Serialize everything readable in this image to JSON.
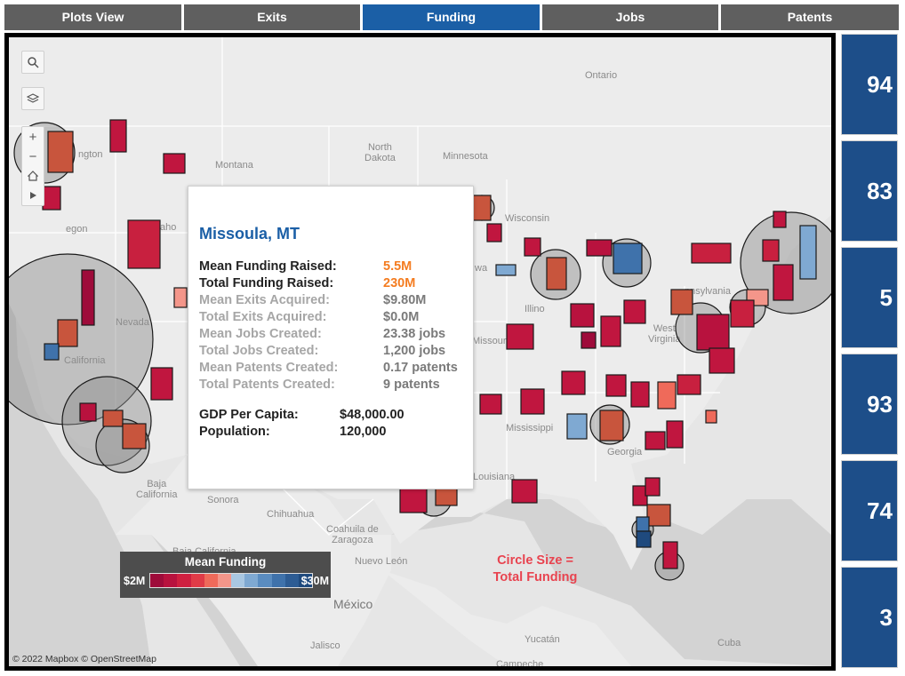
{
  "tabs": [
    {
      "label": "Plots View",
      "active": false
    },
    {
      "label": "Exits",
      "active": false
    },
    {
      "label": "Funding",
      "active": true
    },
    {
      "label": "Jobs",
      "active": false
    },
    {
      "label": "Patents",
      "active": false
    }
  ],
  "map_labels": {
    "ontario": "Ontario",
    "north_dakota": "North\nDakota",
    "minnesota": "Minnesota",
    "montana": "Montana",
    "washington": "ngton",
    "idaho": "aho",
    "oregon": "egon",
    "nevada": "Nevada",
    "california": "California",
    "wisconsin": "Wisconsin",
    "iowa": "wa",
    "illinois": "Illino",
    "missouri": "Missour",
    "pennsylvania": "nnsylvania",
    "west_virginia": "West\nVirginia",
    "mississippi": "Mississippi",
    "georgia": "Georgia",
    "louisiana": "Louisiana",
    "baja_california": "Baja\nCalifornia",
    "sonora": "Sonora",
    "chihuahua": "Chihuahua",
    "coahuila": "Coahuila de\nZaragoza",
    "baja_california_sur": "Baja California",
    "nuevo_leon": "Nuevo León",
    "mexico": "México",
    "jalisco": "Jalisco",
    "yucatan": "Yucatán",
    "cuba": "Cuba",
    "campeche": "Campeche"
  },
  "tooltip": {
    "city": "Missoula, MT",
    "rows": [
      {
        "key": "Mean Funding Raised:",
        "value": "5.5M",
        "style": "highlight"
      },
      {
        "key": "Total Funding Raised:",
        "value": "230M",
        "style": "highlight"
      },
      {
        "key": "Mean Exits Acquired:",
        "value": "$9.80M",
        "style": "muted"
      },
      {
        "key": "Total Exits Acquired:",
        "value": "$0.0M",
        "style": "muted"
      },
      {
        "key": "Mean Jobs Created:",
        "value": "23.38 jobs",
        "style": "muted"
      },
      {
        "key": "Total Jobs Created:",
        "value": "1,200 jobs",
        "style": "muted"
      },
      {
        "key": "Mean Patents Created:",
        "value": "0.17 patents",
        "style": "muted"
      },
      {
        "key": "Total Patents Created:",
        "value": "9 patents",
        "style": "muted"
      }
    ],
    "extra": [
      {
        "key": "GDP Per Capita:",
        "value": "$48,000.00"
      },
      {
        "key": "Population:",
        "value": "120,000"
      }
    ]
  },
  "legend": {
    "title": "Mean Funding",
    "min_label": "$2M",
    "max_label": "$30M",
    "colors": [
      "#9e0b3a",
      "#b8123e",
      "#cf2040",
      "#e03b47",
      "#ef6a5a",
      "#f4968a",
      "#a9c7e2",
      "#7fa9d2",
      "#5a8cc0",
      "#3f72ab",
      "#2d5c94",
      "#1f4a7e"
    ]
  },
  "annotation": "Circle Size =\nTotal Funding",
  "attribution": "© 2022 Mapbox © OpenStreetMap",
  "kpis": [
    "94",
    "83",
    "5",
    "93",
    "74",
    "3"
  ],
  "colors": {
    "active_tab": "#1b5fa6",
    "inactive_tab": "#5f5f5f",
    "kpi_bg": "#1d4e89",
    "annotation": "#e8434f",
    "highlight_value": "#f47c20"
  },
  "icons": {
    "search": "search-icon",
    "layers": "layers-icon",
    "zoom_in": "zoom-in-icon",
    "zoom_out": "zoom-out-icon",
    "home": "home-icon",
    "play": "play-icon"
  }
}
